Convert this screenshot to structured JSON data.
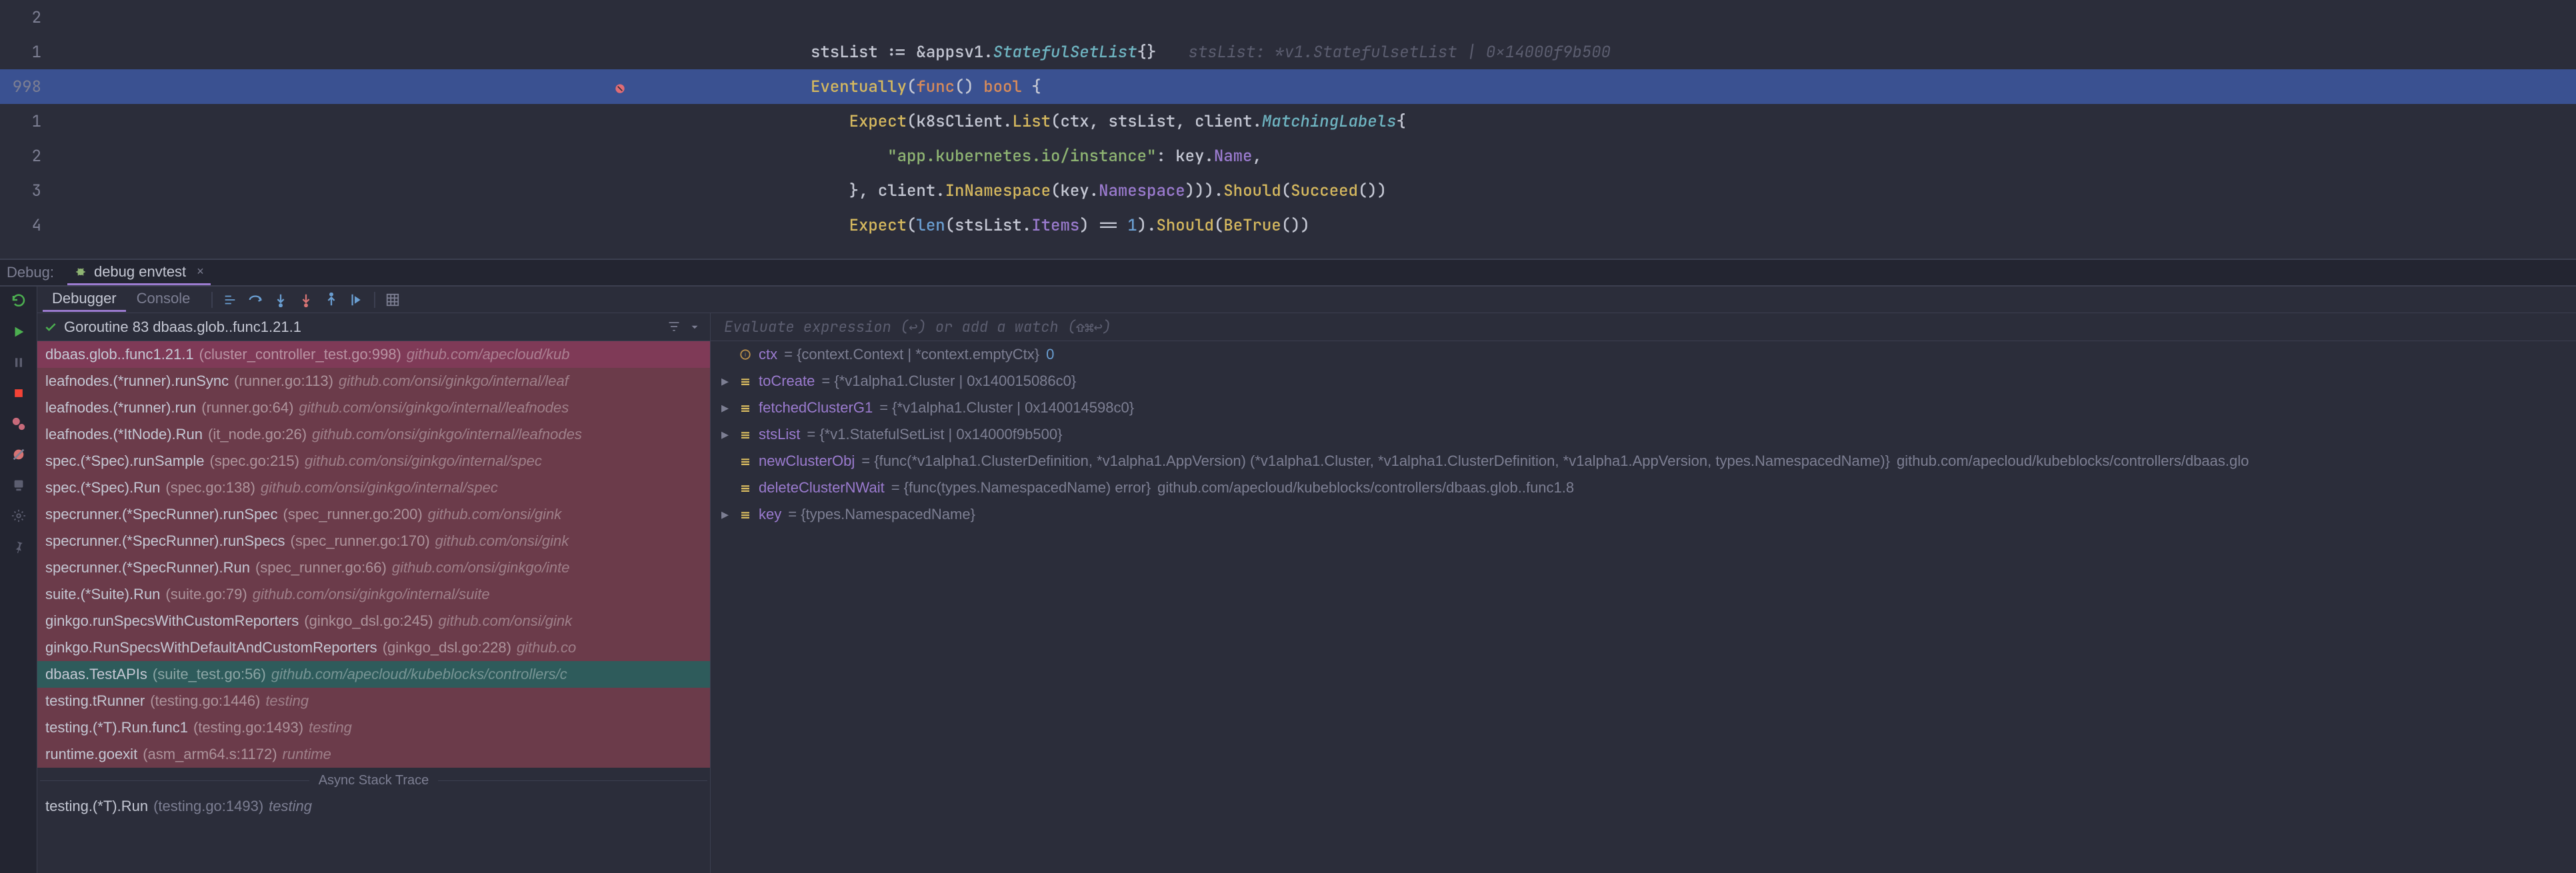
{
  "editor": {
    "gutter": [
      "2",
      "1",
      "998",
      "1",
      "2",
      "3",
      "4"
    ],
    "bp_line_index": 2,
    "inlay0": "stsList: *v1.StatefulsetList | 0x14000f9b500",
    "lines_html": [
      "",
      "<span class='c-id'>stsList</span> <span class='c-op'>:=</span> <span class='c-amp'>&amp;</span><span class='c-pkg'>appsv1</span><span class='c-punc'>.</span><span class='c-type'>StatefulSetList</span><span class='c-punc'>{}</span>",
      "<span class='c-call'>Eventually</span><span class='c-punc'>(</span><span class='c-func'>func</span><span class='c-punc'>()</span> <span class='c-func'>bool</span> <span class='c-punc'>{</span>",
      "    <span class='c-call'>Expect</span><span class='c-punc'>(</span><span class='c-id'>k8sClient</span><span class='c-punc'>.</span><span class='c-call'>List</span><span class='c-punc'>(</span><span class='c-id'>ctx</span><span class='c-punc'>,</span> <span class='c-id'>stsList</span><span class='c-punc'>,</span> <span class='c-pkg'>client</span><span class='c-punc'>.</span><span class='c-type'>MatchingLabels</span><span class='c-punc'>{</span>",
      "        <span class='c-str'>\"app.kubernetes.io/instance\"</span><span class='c-punc'>:</span> <span class='c-id'>key</span><span class='c-punc'>.</span><span class='c-field'>Name</span><span class='c-punc'>,</span>",
      "    <span class='c-punc'>},</span> <span class='c-pkg'>client</span><span class='c-punc'>.</span><span class='c-call'>InNamespace</span><span class='c-punc'>(</span><span class='c-id'>key</span><span class='c-punc'>.</span><span class='c-field'>Namespace</span><span class='c-punc'>)))</span><span class='c-punc'>.</span><span class='c-call'>Should</span><span class='c-punc'>(</span><span class='c-call'>Succeed</span><span class='c-punc'>())</span>",
      "    <span class='c-call'>Expect</span><span class='c-punc'>(</span><span class='c-builtin'>len</span><span class='c-punc'>(</span><span class='c-id'>stsList</span><span class='c-punc'>.</span><span class='c-field'>Items</span><span class='c-punc'>)</span> <span class='c-op'>==</span> <span class='c-num'>1</span><span class='c-punc'>).</span><span class='c-call'>Should</span><span class='c-punc'>(</span><span class='c-call'>BeTrue</span><span class='c-punc'>())</span>"
    ]
  },
  "debug": {
    "label": "Debug:",
    "tab": "debug envtest"
  },
  "panel": {
    "tabs": {
      "debugger": "Debugger",
      "console": "Console"
    }
  },
  "frames": {
    "header": "Goroutine 83 dbaas.glob..func1.21.1",
    "async": "Async Stack Trace",
    "rows": [
      {
        "style": "selected",
        "fn": "dbaas.glob..func1.21.1",
        "loc": "(cluster_controller_test.go:998)",
        "pkg": "github.com/apecloud/kub"
      },
      {
        "style": "frame",
        "fn": "leafnodes.(*runner).runSync",
        "loc": "(runner.go:113)",
        "pkg": "github.com/onsi/ginkgo/internal/leaf"
      },
      {
        "style": "frame",
        "fn": "leafnodes.(*runner).run",
        "loc": "(runner.go:64)",
        "pkg": "github.com/onsi/ginkgo/internal/leafnodes"
      },
      {
        "style": "frame",
        "fn": "leafnodes.(*ItNode).Run",
        "loc": "(it_node.go:26)",
        "pkg": "github.com/onsi/ginkgo/internal/leafnodes"
      },
      {
        "style": "frame",
        "fn": "spec.(*Spec).runSample",
        "loc": "(spec.go:215)",
        "pkg": "github.com/onsi/ginkgo/internal/spec"
      },
      {
        "style": "frame",
        "fn": "spec.(*Spec).Run",
        "loc": "(spec.go:138)",
        "pkg": "github.com/onsi/ginkgo/internal/spec"
      },
      {
        "style": "frame",
        "fn": "specrunner.(*SpecRunner).runSpec",
        "loc": "(spec_runner.go:200)",
        "pkg": "github.com/onsi/gink"
      },
      {
        "style": "frame",
        "fn": "specrunner.(*SpecRunner).runSpecs",
        "loc": "(spec_runner.go:170)",
        "pkg": "github.com/onsi/gink"
      },
      {
        "style": "frame",
        "fn": "specrunner.(*SpecRunner).Run",
        "loc": "(spec_runner.go:66)",
        "pkg": "github.com/onsi/ginkgo/inte"
      },
      {
        "style": "frame",
        "fn": "suite.(*Suite).Run",
        "loc": "(suite.go:79)",
        "pkg": "github.com/onsi/ginkgo/internal/suite"
      },
      {
        "style": "frame",
        "fn": "ginkgo.runSpecsWithCustomReporters",
        "loc": "(ginkgo_dsl.go:245)",
        "pkg": "github.com/onsi/gink"
      },
      {
        "style": "frame",
        "fn": "ginkgo.RunSpecsWithDefaultAndCustomReporters",
        "loc": "(ginkgo_dsl.go:228)",
        "pkg": "github.co"
      },
      {
        "style": "teal",
        "fn": "dbaas.TestAPIs",
        "loc": "(suite_test.go:56)",
        "pkg": "github.com/apecloud/kubeblocks/controllers/c"
      },
      {
        "style": "frame",
        "fn": "testing.tRunner",
        "loc": "(testing.go:1446)",
        "pkg": "testing"
      },
      {
        "style": "frame",
        "fn": "testing.(*T).Run.func1",
        "loc": "(testing.go:1493)",
        "pkg": "testing"
      },
      {
        "style": "frame",
        "fn": "runtime.goexit",
        "loc": "(asm_arm64.s:1172)",
        "pkg": "runtime"
      }
    ],
    "rows2": [
      {
        "style": "plain",
        "fn": "testing.(*T).Run",
        "loc": "(testing.go:1493)",
        "pkg": "testing"
      }
    ]
  },
  "watch": {
    "placeholder": "Evaluate expression (↩) or add a watch (⇧⌘↩)"
  },
  "vars": [
    {
      "arrow": false,
      "kind": "iface",
      "name": "ctx",
      "eq": " = ",
      "type": "{context.Context | *context.emptyCtx} ",
      "hex": "0"
    },
    {
      "arrow": true,
      "kind": "struct",
      "name": "toCreate",
      "eq": " = ",
      "type": "{*v1alpha1.Cluster | 0x140015086c0}"
    },
    {
      "arrow": true,
      "kind": "struct",
      "name": "fetchedClusterG1",
      "eq": " = ",
      "type": "{*v1alpha1.Cluster | 0x140014598c0}"
    },
    {
      "arrow": true,
      "kind": "struct",
      "name": "stsList",
      "eq": " = ",
      "type": "{*v1.StatefulSetList | 0x14000f9b500}"
    },
    {
      "arrow": false,
      "kind": "struct",
      "name": "newClusterObj",
      "eq": " = ",
      "type": "{func(*v1alpha1.ClusterDefinition, *v1alpha1.AppVersion) (*v1alpha1.Cluster, *v1alpha1.ClusterDefinition, *v1alpha1.AppVersion, types.NamespacedName)} ",
      "pkg": "github.com/apecloud/kubeblocks/controllers/dbaas.glo"
    },
    {
      "arrow": false,
      "kind": "struct",
      "name": "deleteClusterNWait",
      "eq": " = ",
      "type": "{func(types.NamespacedName) error} ",
      "pkg": "github.com/apecloud/kubeblocks/controllers/dbaas.glob..func1.8"
    },
    {
      "arrow": true,
      "kind": "struct",
      "name": "key",
      "eq": " = ",
      "type": "{types.NamespacedName}"
    }
  ]
}
